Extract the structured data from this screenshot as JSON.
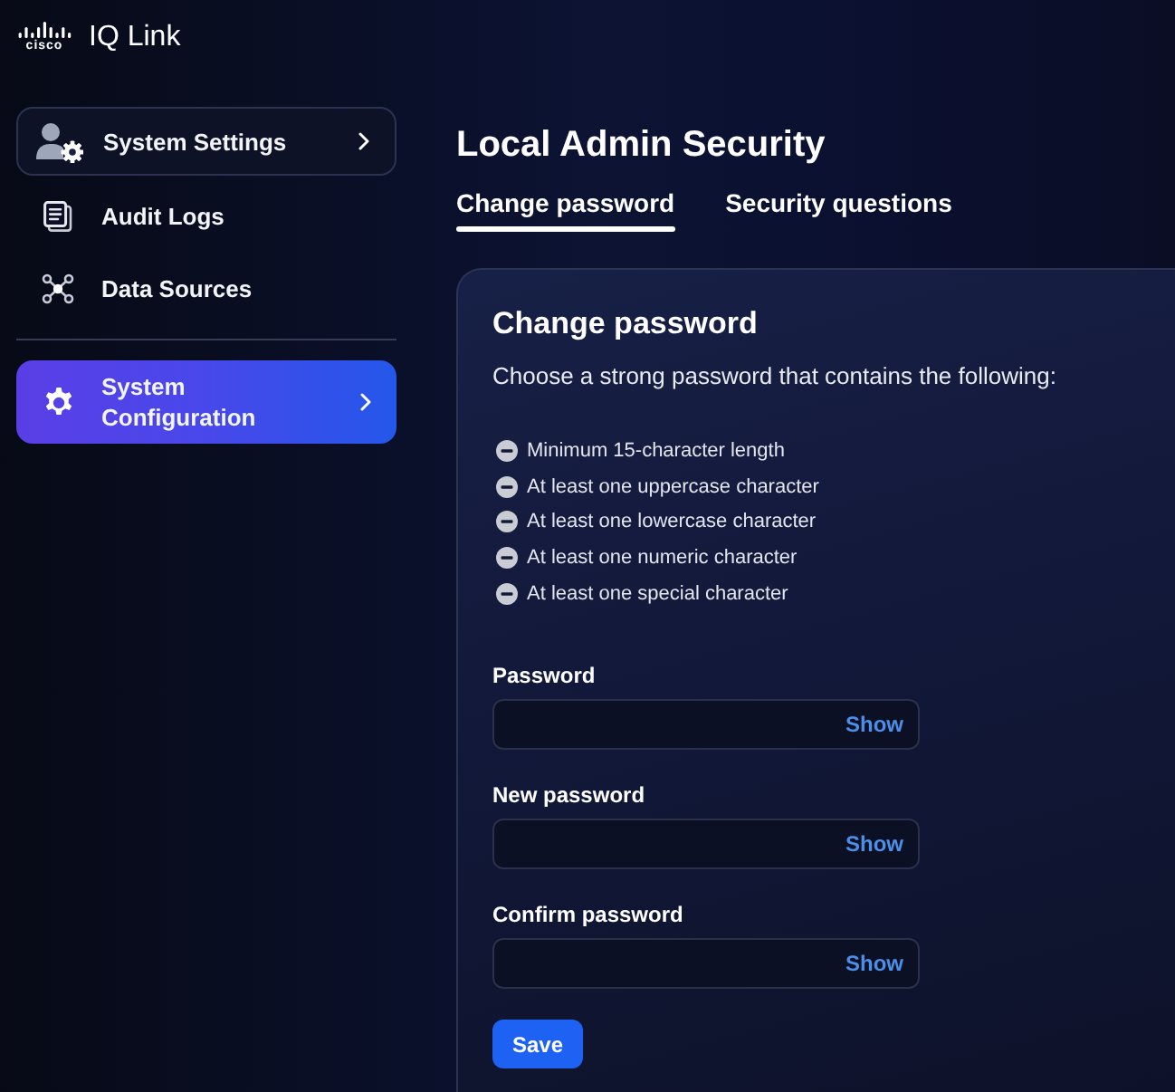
{
  "brand": {
    "logo_text": "cisco",
    "title": "IQ Link"
  },
  "sidebar": {
    "sections": [
      {
        "items": [
          {
            "kind": "group",
            "label": "System Settings",
            "selected": false
          },
          {
            "kind": "link",
            "label": "Audit Logs",
            "selected": false
          },
          {
            "kind": "link",
            "label": "Data Sources",
            "selected": false
          }
        ]
      },
      {
        "items": [
          {
            "kind": "group",
            "label": "System Configuration",
            "selected": true
          }
        ]
      }
    ]
  },
  "page_title": "Local Admin Security",
  "tabs": [
    {
      "label": "Change password",
      "selected": true
    },
    {
      "label": "Security questions",
      "selected": false
    }
  ],
  "card": {
    "title": "Change password",
    "description": "Choose a strong password that contains the following:",
    "requirements": [
      {
        "label": "Minimum 15-character length",
        "met": false
      },
      {
        "label": "At least one uppercase character",
        "met": false
      },
      {
        "label": "At least one lowercase character",
        "met": false
      },
      {
        "label": "At least one numeric character",
        "met": false
      },
      {
        "label": "At least one special character",
        "met": false
      }
    ],
    "fields": [
      {
        "label": "Password",
        "toggle": "Show"
      },
      {
        "label": "New password",
        "toggle": "Show"
      },
      {
        "label": "Confirm password",
        "toggle": "Show"
      }
    ],
    "submit": "Save"
  }
}
